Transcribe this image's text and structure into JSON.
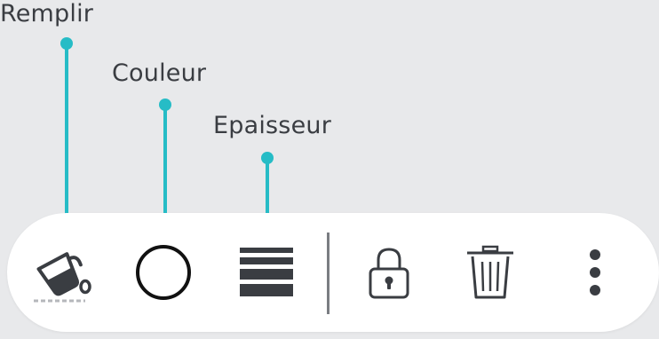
{
  "callouts": {
    "fill_label": "Remplir",
    "color_label": "Couleur",
    "thickness_label": "Epaisseur"
  },
  "toolbar": {
    "icons": {
      "fill": "paint-bucket-icon",
      "color": "circle-outline-icon",
      "thickness": "line-thickness-icon",
      "lock": "lock-icon",
      "delete": "trash-icon",
      "more": "more-vertical-icon"
    }
  },
  "colors": {
    "accent": "#26bcc6",
    "icon": "#3a3d42",
    "background": "#e8e9eb",
    "toolbar": "#ffffff"
  }
}
